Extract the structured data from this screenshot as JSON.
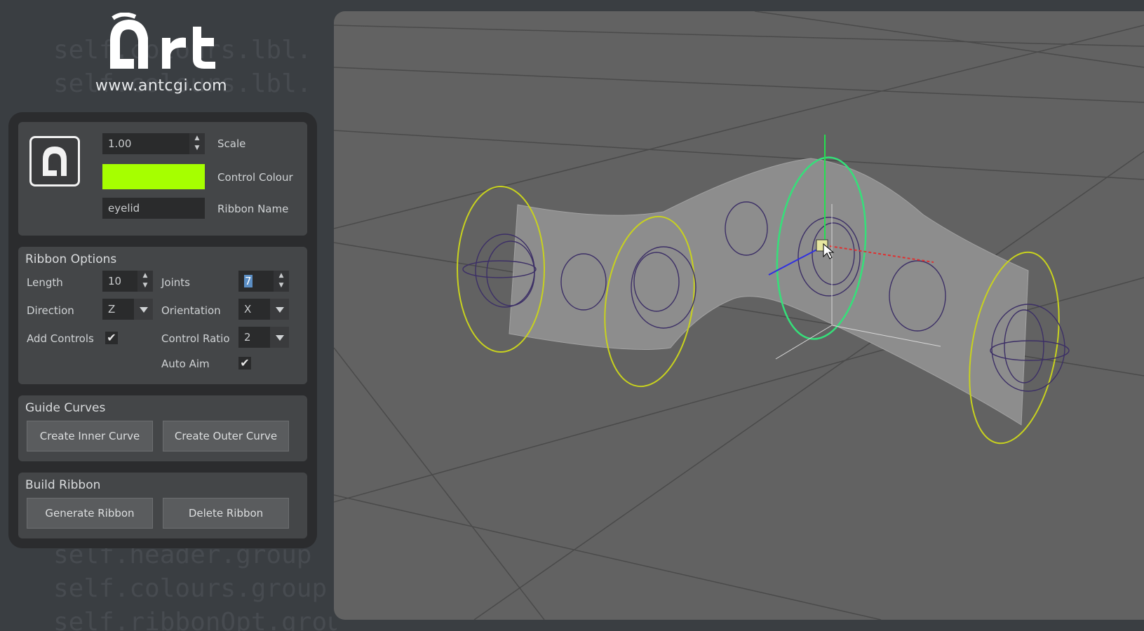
{
  "logo": {
    "brand": "Art",
    "url": "www.antcgi.com"
  },
  "header": {
    "scale_value": "1.00",
    "scale_label": "Scale",
    "colour_label": "Control Colour",
    "control_colour": "#a6ff00",
    "ribbon_name_value": "eyelid",
    "ribbon_name_label": "Ribbon Name"
  },
  "ribbon_options": {
    "title": "Ribbon Options",
    "length_label": "Length",
    "length_value": "10",
    "joints_label": "Joints",
    "joints_value": "7",
    "direction_label": "Direction",
    "direction_value": "Z",
    "orientation_label": "Orientation",
    "orientation_value": "X",
    "add_controls_label": "Add Controls",
    "add_controls_checked": true,
    "control_ratio_label": "Control Ratio",
    "control_ratio_value": "2",
    "auto_aim_label": "Auto Aim",
    "auto_aim_checked": true
  },
  "guide_curves": {
    "title": "Guide Curves",
    "inner_label": "Create Inner Curve",
    "outer_label": "Create Outer Curve"
  },
  "build_ribbon": {
    "title": "Build Ribbon",
    "generate_label": "Generate Ribbon",
    "delete_label": "Delete Ribbon"
  },
  "background_code": [
    "self.colours.lbl.",
    "self.colours.lbl.",
    "",
    "",
    "",
    "",
    "",
    "",
    "",
    "",
    "",
    "",
    "",
    "",
    "",
    "self.header.group",
    "self.colours.group",
    "self.ribbonOpt.group"
  ],
  "colors": {
    "accent": "#a6ff00",
    "viewport": "#626262",
    "panel": "#2b2c2e"
  }
}
